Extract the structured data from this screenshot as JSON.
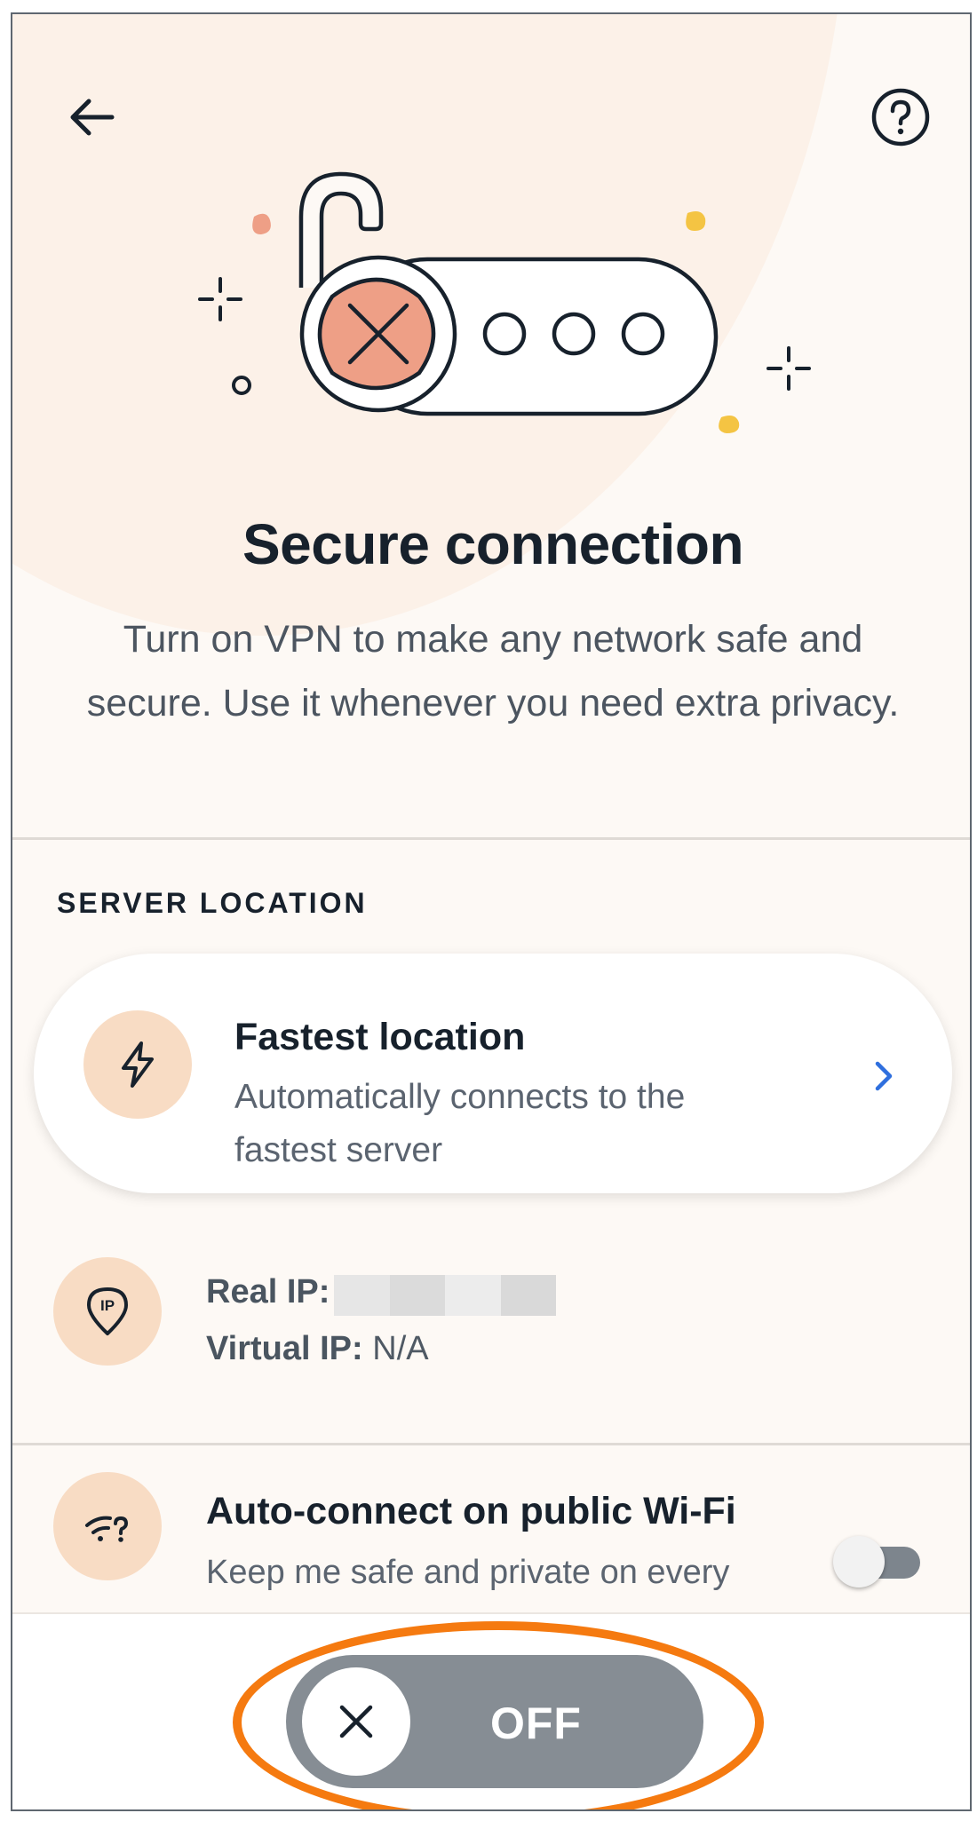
{
  "header": {
    "back_icon": "arrow-left-icon",
    "help_icon": "question-circle-icon"
  },
  "hero": {
    "illustration": "unlocked-padlock-icon",
    "title": "Secure connection",
    "description": "Turn on VPN to make any network safe and secure. Use it whenever you need extra privacy."
  },
  "server_location": {
    "section_label": "SERVER LOCATION",
    "card_icon": "lightning-icon",
    "card_title": "Fastest location",
    "card_subtitle": "Automatically connects to the fastest server",
    "chevron_icon": "chevron-right-icon"
  },
  "ip_info": {
    "icon": "ip-pin-icon",
    "real_ip_label": "Real IP:",
    "real_ip_value": "",
    "virtual_ip_label": "Virtual IP:",
    "virtual_ip_value": "N/A"
  },
  "auto_connect": {
    "icon": "wifi-question-icon",
    "title": "Auto-connect on public Wi-Fi",
    "subtitle": "Keep me safe and private on every",
    "enabled": false
  },
  "vpn_switch": {
    "state_label": "OFF",
    "knob_icon": "close-icon",
    "enabled": false
  },
  "colors": {
    "accent_orange": "#f57a10",
    "icon_bg": "#f8dcc4",
    "link_blue": "#2f6fde",
    "switch_off": "#868d94",
    "lock_red": "#ee9f86",
    "sparkle_yellow": "#f4c443"
  }
}
